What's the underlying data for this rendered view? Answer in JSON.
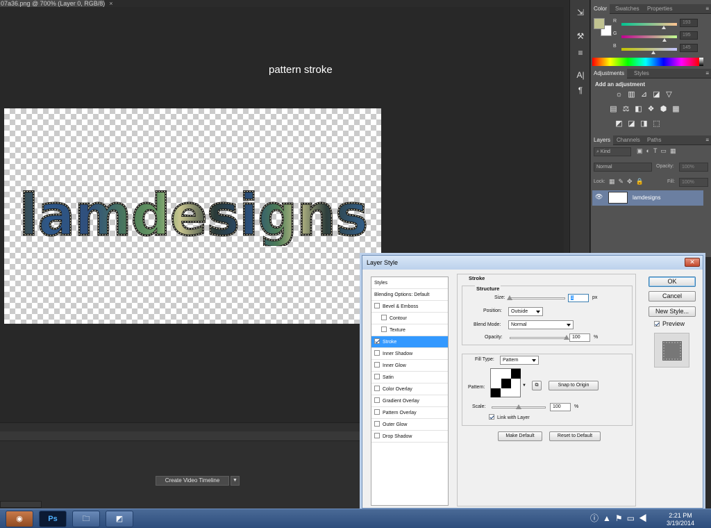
{
  "document": {
    "tab_title": "07a36.png @ 700% (Layer 0, RGB/8)",
    "tab_close": "×",
    "canvas_label": "pattern stroke",
    "artwork_text": "lamdesigns"
  },
  "timeline": {
    "button_label": "Create Video Timeline",
    "arrow": "▼"
  },
  "tools": [
    "⇲",
    "⚒",
    "≡",
    "A|",
    "¶"
  ],
  "color_panel": {
    "tabs": [
      "Color",
      "Swatches",
      "Properties"
    ],
    "menu": "≡",
    "sliders": [
      {
        "label": "R",
        "value": "193",
        "fraction": 0.76
      },
      {
        "label": "G",
        "value": "195",
        "fraction": 0.77
      },
      {
        "label": "B",
        "value": "145",
        "fraction": 0.57
      }
    ],
    "foreground": "#c1c391",
    "background": "#ffffff"
  },
  "adjustments_panel": {
    "tabs": [
      "Adjustments",
      "Styles"
    ],
    "heading": "Add an adjustment",
    "rows": [
      [
        "☼",
        "▥",
        "⊿",
        "◪",
        "▽"
      ],
      [
        "▤",
        "⚖",
        "◧",
        "❖",
        "⬢",
        "▦"
      ],
      [
        "◩",
        "◪",
        "◨",
        "⬚"
      ]
    ]
  },
  "layers_panel": {
    "tabs": [
      "Layers",
      "Channels",
      "Paths"
    ],
    "filter_label": "Kind",
    "blend_mode": "Normal",
    "opacity_label": "Opacity:",
    "opacity_value": "100%",
    "lock_label": "Lock:",
    "fill_label": "Fill:",
    "fill_value": "100%",
    "layer_name": "lamdesigns",
    "eye": "👁"
  },
  "dialog": {
    "title": "Layer Style",
    "close": "✕",
    "styles_header": "Styles",
    "blending_options": "Blending Options: Default",
    "items": [
      {
        "label": "Bevel & Emboss",
        "checked": false,
        "indent": false
      },
      {
        "label": "Contour",
        "checked": false,
        "indent": true
      },
      {
        "label": "Texture",
        "checked": false,
        "indent": true
      },
      {
        "label": "Stroke",
        "checked": true,
        "indent": false,
        "selected": true
      },
      {
        "label": "Inner Shadow",
        "checked": false,
        "indent": false
      },
      {
        "label": "Inner Glow",
        "checked": false,
        "indent": false
      },
      {
        "label": "Satin",
        "checked": false,
        "indent": false
      },
      {
        "label": "Color Overlay",
        "checked": false,
        "indent": false
      },
      {
        "label": "Gradient Overlay",
        "checked": false,
        "indent": false
      },
      {
        "label": "Pattern Overlay",
        "checked": false,
        "indent": false
      },
      {
        "label": "Outer Glow",
        "checked": false,
        "indent": false
      },
      {
        "label": "Drop Shadow",
        "checked": false,
        "indent": false
      }
    ],
    "stroke": {
      "heading": "Stroke",
      "structure": "Structure",
      "size_label": "Size:",
      "size_value": "1",
      "size_unit": "px",
      "size_fraction": 0.0,
      "position_label": "Position:",
      "position_value": "Outside",
      "blend_label": "Blend Mode:",
      "blend_value": "Normal",
      "opacity_label": "Opacity:",
      "opacity_value": "100",
      "opacity_unit": "%",
      "opacity_fraction": 1.0,
      "fill_type_label": "Fill Type:",
      "fill_type_value": "Pattern",
      "pattern_label": "Pattern:",
      "snap_button": "Snap to Origin",
      "scale_label": "Scale:",
      "scale_value": "100",
      "scale_unit": "%",
      "scale_fraction": 0.5,
      "link_label": "Link with Layer",
      "link_checked": true,
      "make_default": "Make Default",
      "reset_default": "Reset to Default"
    },
    "buttons": {
      "ok": "OK",
      "cancel": "Cancel",
      "new_style": "New Style..."
    },
    "preview_label": "Preview",
    "preview_checked": true
  },
  "taskbar": {
    "ps_label": "Ps",
    "time": "2:21 PM",
    "date": "3/19/2014"
  }
}
